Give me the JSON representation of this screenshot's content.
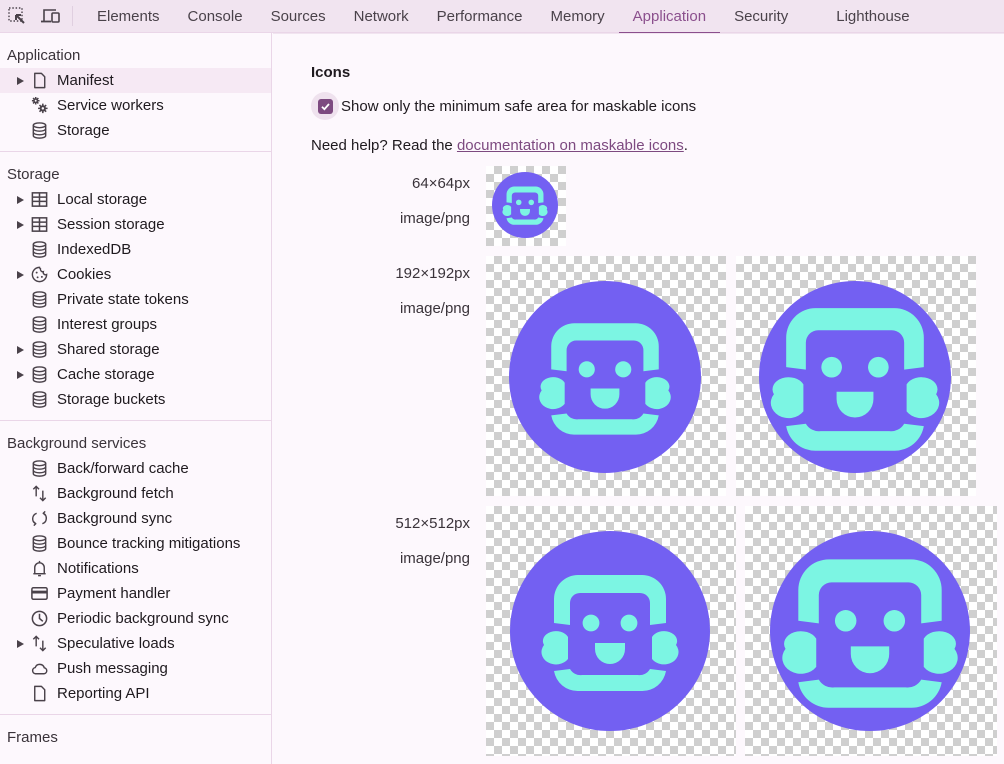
{
  "toolbar": {
    "tabs": [
      {
        "label": "Elements"
      },
      {
        "label": "Console"
      },
      {
        "label": "Sources"
      },
      {
        "label": "Network"
      },
      {
        "label": "Performance"
      },
      {
        "label": "Memory"
      },
      {
        "label": "Application",
        "active": true
      },
      {
        "label": "Security"
      },
      {
        "label": "Lighthouse"
      }
    ],
    "icons": [
      "element-picker-icon",
      "device-toolbar-icon"
    ]
  },
  "sidebar": {
    "sections": [
      {
        "title": "Application",
        "items": [
          {
            "label": "Manifest",
            "icon": "document-icon",
            "expandable": true,
            "selected": true
          },
          {
            "label": "Service workers",
            "icon": "gears-icon"
          },
          {
            "label": "Storage",
            "icon": "database-icon"
          }
        ]
      },
      {
        "title": "Storage",
        "items": [
          {
            "label": "Local storage",
            "icon": "table-icon",
            "expandable": true
          },
          {
            "label": "Session storage",
            "icon": "table-icon",
            "expandable": true
          },
          {
            "label": "IndexedDB",
            "icon": "database-icon"
          },
          {
            "label": "Cookies",
            "icon": "cookie-icon",
            "expandable": true
          },
          {
            "label": "Private state tokens",
            "icon": "database-icon"
          },
          {
            "label": "Interest groups",
            "icon": "database-icon"
          },
          {
            "label": "Shared storage",
            "icon": "database-icon",
            "expandable": true
          },
          {
            "label": "Cache storage",
            "icon": "database-icon",
            "expandable": true
          },
          {
            "label": "Storage buckets",
            "icon": "database-icon"
          }
        ]
      },
      {
        "title": "Background services",
        "items": [
          {
            "label": "Back/forward cache",
            "icon": "database-icon"
          },
          {
            "label": "Background fetch",
            "icon": "up-down-arrows-icon"
          },
          {
            "label": "Background sync",
            "icon": "sync-icon"
          },
          {
            "label": "Bounce tracking mitigations",
            "icon": "database-icon"
          },
          {
            "label": "Notifications",
            "icon": "bell-icon"
          },
          {
            "label": "Payment handler",
            "icon": "credit-card-icon"
          },
          {
            "label": "Periodic background sync",
            "icon": "clock-icon"
          },
          {
            "label": "Speculative loads",
            "icon": "up-down-arrows-icon",
            "expandable": true
          },
          {
            "label": "Push messaging",
            "icon": "cloud-icon"
          },
          {
            "label": "Reporting API",
            "icon": "document-icon"
          }
        ]
      },
      {
        "title": "Frames",
        "items": []
      }
    ]
  },
  "main": {
    "heading": "Icons",
    "checkbox": {
      "label": "Show only the minimum safe area for maskable icons",
      "checked": true
    },
    "help": {
      "prefix": "Need help? Read the ",
      "link": "documentation on maskable icons",
      "suffix": "."
    },
    "icons": [
      {
        "size": "64×64px",
        "type": "image/png",
        "variants": [
          "masked"
        ]
      },
      {
        "size": "192×192px",
        "type": "image/png",
        "variants": [
          "masked",
          "safe-area"
        ]
      },
      {
        "size": "512×512px",
        "type": "image/png",
        "variants": [
          "masked",
          "safe-area"
        ]
      }
    ]
  },
  "colors": {
    "accent": "#8b4f8d",
    "icon_background": "#7360f2",
    "icon_foreground": "#7cf5e3"
  }
}
